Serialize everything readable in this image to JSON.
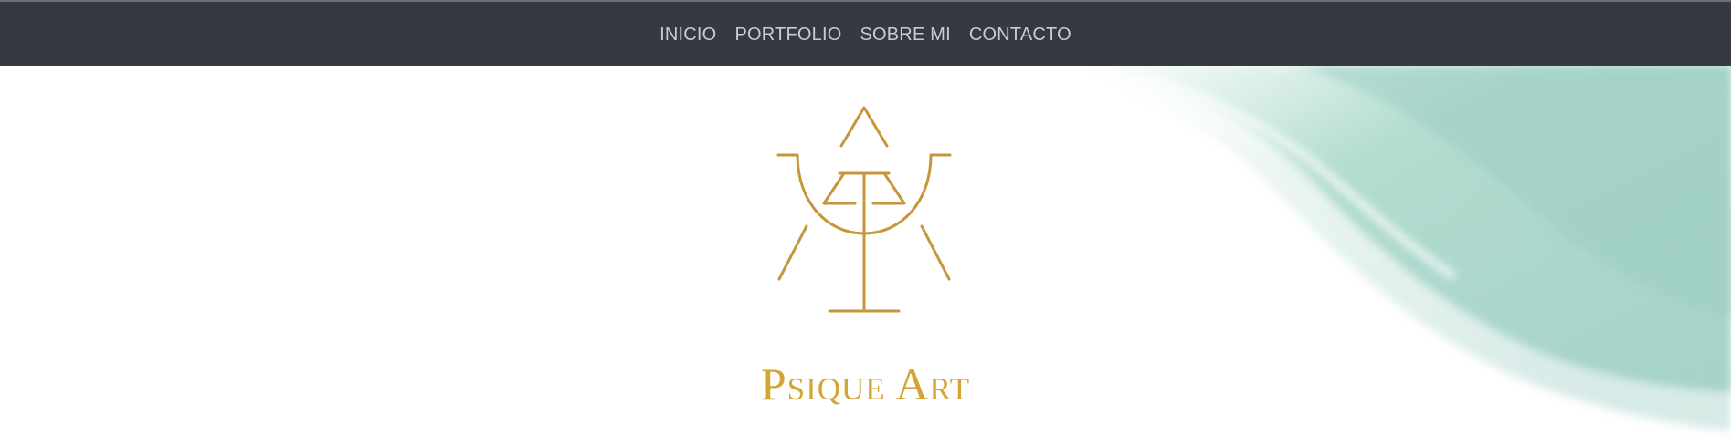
{
  "nav": {
    "items": [
      {
        "label": "INICIO"
      },
      {
        "label": "PORTFOLIO"
      },
      {
        "label": "SOBRE MI"
      },
      {
        "label": "CONTACTO"
      }
    ]
  },
  "hero": {
    "brand_name": "Psique Art",
    "logo_icon": "psique-art-symbol-icon",
    "decoration": "watercolor-wave"
  },
  "colors": {
    "navbar_bg": "#353a41",
    "nav_text": "#c9ccd0",
    "gold": "#c7953a",
    "brand_text": "#d4a534",
    "wave_mint": "#a9d6c8"
  }
}
